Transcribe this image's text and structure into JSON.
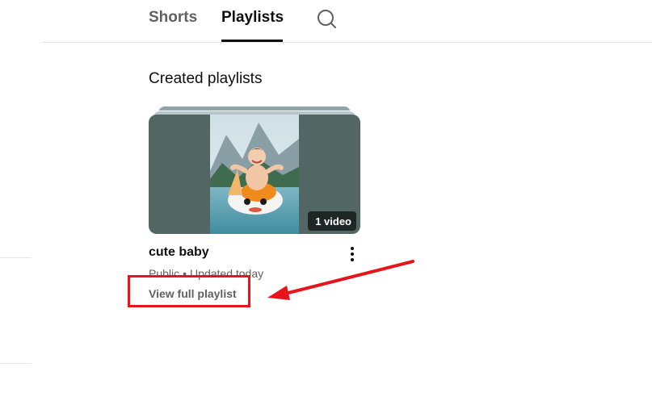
{
  "tabs": {
    "shorts": "Shorts",
    "playlists": "Playlists",
    "active": "Playlists",
    "search_icon": "search-icon"
  },
  "section": {
    "title": "Created playlists"
  },
  "playlist": {
    "title": "cute baby",
    "video_count": "1 video",
    "badge_icon": "playlist-icon",
    "visibility": "Public",
    "separator": "•",
    "updated": "Updated today",
    "view_link": "View full playlist",
    "menu_icon": "more-vert-icon"
  },
  "annotation": {
    "color": "#e8141c",
    "box_icon": "highlight-box",
    "arrow_icon": "arrow-icon"
  }
}
